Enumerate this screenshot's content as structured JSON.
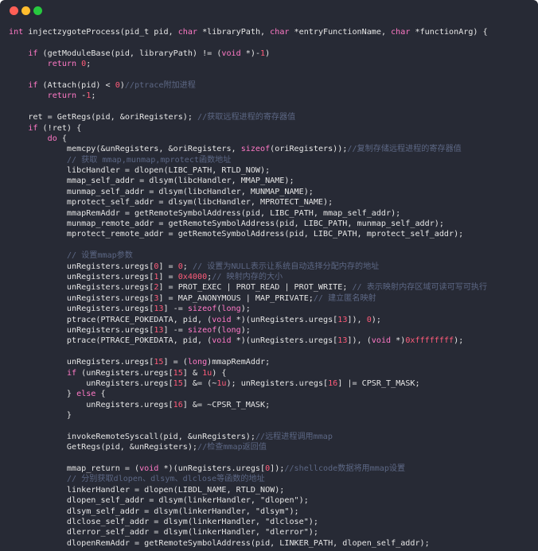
{
  "window": {
    "buttons": [
      {
        "name": "close-button",
        "color": "#ff5f56"
      },
      {
        "name": "minimize-button",
        "color": "#ffbd2e"
      },
      {
        "name": "maximize-button",
        "color": "#27c93f"
      }
    ]
  },
  "colors": {
    "background": "#272a35",
    "text": "#e6e6e6",
    "keyword": "#ff79c6",
    "number": "#ff5c7a",
    "comment": "#5c6784"
  },
  "code": {
    "lines": [
      [
        [
          "k",
          "int"
        ],
        [
          "t",
          " injectzygoteProcess(pid_t pid, "
        ],
        [
          "k",
          "char"
        ],
        [
          "t",
          " *libraryPath, "
        ],
        [
          "k",
          "char"
        ],
        [
          "t",
          " *entryFunctionName, "
        ],
        [
          "k",
          "char"
        ],
        [
          "t",
          " *functionArg) {"
        ]
      ],
      [],
      [
        [
          "t",
          "    "
        ],
        [
          "k",
          "if"
        ],
        [
          "t",
          " (getModuleBase(pid, libraryPath) != ("
        ],
        [
          "k",
          "void"
        ],
        [
          "t",
          " *)-"
        ],
        [
          "n",
          "1"
        ],
        [
          "t",
          ")"
        ]
      ],
      [
        [
          "t",
          "        "
        ],
        [
          "k",
          "return"
        ],
        [
          "t",
          " "
        ],
        [
          "n",
          "0"
        ],
        [
          "t",
          ";"
        ]
      ],
      [],
      [
        [
          "t",
          "    "
        ],
        [
          "k",
          "if"
        ],
        [
          "t",
          " (Attach(pid) < "
        ],
        [
          "n",
          "0"
        ],
        [
          "t",
          ")"
        ],
        [
          "c",
          "//ptrace附加进程"
        ]
      ],
      [
        [
          "t",
          "        "
        ],
        [
          "k",
          "return"
        ],
        [
          "t",
          " -"
        ],
        [
          "n",
          "1"
        ],
        [
          "t",
          ";"
        ]
      ],
      [],
      [
        [
          "t",
          "    ret = GetRegs(pid, &oriRegisters); "
        ],
        [
          "c",
          "//获取远程进程的寄存器值"
        ]
      ],
      [
        [
          "t",
          "    "
        ],
        [
          "k",
          "if"
        ],
        [
          "t",
          " (!ret) {"
        ]
      ],
      [
        [
          "t",
          "        "
        ],
        [
          "k",
          "do"
        ],
        [
          "t",
          " {"
        ]
      ],
      [
        [
          "t",
          "            memcpy(&unRegisters, &oriRegisters, "
        ],
        [
          "k",
          "sizeof"
        ],
        [
          "t",
          "(oriRegisters));"
        ],
        [
          "c",
          "//复制存储远程进程的寄存器值"
        ]
      ],
      [
        [
          "t",
          "            "
        ],
        [
          "c",
          "// 获取 mmap,munmap,mprotect函数地址"
        ]
      ],
      [
        [
          "t",
          "            libcHandler = dlopen(LIBC_PATH, RTLD_NOW);"
        ]
      ],
      [
        [
          "t",
          "            mmap_self_addr = dlsym(libcHandler, MMAP_NAME);"
        ]
      ],
      [
        [
          "t",
          "            munmap_self_addr = dlsym(libcHandler, MUNMAP_NAME);"
        ]
      ],
      [
        [
          "t",
          "            mprotect_self_addr = dlsym(libcHandler, MPROTECT_NAME);"
        ]
      ],
      [
        [
          "t",
          "            mmapRemAddr = getRemoteSymbolAddress(pid, LIBC_PATH, mmap_self_addr);"
        ]
      ],
      [
        [
          "t",
          "            munmap_remote_addr = getRemoteSymbolAddress(pid, LIBC_PATH, munmap_self_addr);"
        ]
      ],
      [
        [
          "t",
          "            mprotect_remote_addr = getRemoteSymbolAddress(pid, LIBC_PATH, mprotect_self_addr);"
        ]
      ],
      [],
      [
        [
          "t",
          "            "
        ],
        [
          "c",
          "// 设置mmap参数"
        ]
      ],
      [
        [
          "t",
          "            unRegisters.uregs["
        ],
        [
          "n",
          "0"
        ],
        [
          "t",
          "] = "
        ],
        [
          "n",
          "0"
        ],
        [
          "t",
          "; "
        ],
        [
          "c",
          "// 设置为NULL表示让系统自动选择分配内存的地址"
        ]
      ],
      [
        [
          "t",
          "            unRegisters.uregs["
        ],
        [
          "n",
          "1"
        ],
        [
          "t",
          "] = "
        ],
        [
          "n",
          "0x4000"
        ],
        [
          "t",
          ";"
        ],
        [
          "c",
          "// 映射内存的大小"
        ]
      ],
      [
        [
          "t",
          "            unRegisters.uregs["
        ],
        [
          "n",
          "2"
        ],
        [
          "t",
          "] = PROT_EXEC | PROT_READ | PROT_WRITE; "
        ],
        [
          "c",
          "// 表示映射内存区域可读可写可执行"
        ]
      ],
      [
        [
          "t",
          "            unRegisters.uregs["
        ],
        [
          "n",
          "3"
        ],
        [
          "t",
          "] = MAP_ANONYMOUS | MAP_PRIVATE;"
        ],
        [
          "c",
          "// 建立匿名映射"
        ]
      ],
      [
        [
          "t",
          "            unRegisters.uregs["
        ],
        [
          "n",
          "13"
        ],
        [
          "t",
          "] -= "
        ],
        [
          "k",
          "sizeof"
        ],
        [
          "t",
          "("
        ],
        [
          "k",
          "long"
        ],
        [
          "t",
          ");"
        ]
      ],
      [
        [
          "t",
          "            ptrace(PTRACE_POKEDATA, pid, ("
        ],
        [
          "k",
          "void"
        ],
        [
          "t",
          " *)(unRegisters.uregs["
        ],
        [
          "n",
          "13"
        ],
        [
          "t",
          "]), "
        ],
        [
          "n",
          "0"
        ],
        [
          "t",
          ");"
        ]
      ],
      [
        [
          "t",
          "            unRegisters.uregs["
        ],
        [
          "n",
          "13"
        ],
        [
          "t",
          "] -= "
        ],
        [
          "k",
          "sizeof"
        ],
        [
          "t",
          "("
        ],
        [
          "k",
          "long"
        ],
        [
          "t",
          ");"
        ]
      ],
      [
        [
          "t",
          "            ptrace(PTRACE_POKEDATA, pid, ("
        ],
        [
          "k",
          "void"
        ],
        [
          "t",
          " *)(unRegisters.uregs["
        ],
        [
          "n",
          "13"
        ],
        [
          "t",
          "]), ("
        ],
        [
          "k",
          "void"
        ],
        [
          "t",
          " *)"
        ],
        [
          "n",
          "0xffffffff"
        ],
        [
          "t",
          ");"
        ]
      ],
      [],
      [
        [
          "t",
          "            unRegisters.uregs["
        ],
        [
          "n",
          "15"
        ],
        [
          "t",
          "] = ("
        ],
        [
          "k",
          "long"
        ],
        [
          "t",
          ")mmapRemAddr;"
        ]
      ],
      [
        [
          "t",
          "            "
        ],
        [
          "k",
          "if"
        ],
        [
          "t",
          " (unRegisters.uregs["
        ],
        [
          "n",
          "15"
        ],
        [
          "t",
          "] & "
        ],
        [
          "n",
          "1u"
        ],
        [
          "t",
          ") {"
        ]
      ],
      [
        [
          "t",
          "                unRegisters.uregs["
        ],
        [
          "n",
          "15"
        ],
        [
          "t",
          "] &= (~"
        ],
        [
          "n",
          "1u"
        ],
        [
          "t",
          "); unRegisters.uregs["
        ],
        [
          "n",
          "16"
        ],
        [
          "t",
          "] |= CPSR_T_MASK;"
        ]
      ],
      [
        [
          "t",
          "            } "
        ],
        [
          "k",
          "else"
        ],
        [
          "t",
          " {"
        ]
      ],
      [
        [
          "t",
          "                unRegisters.uregs["
        ],
        [
          "n",
          "16"
        ],
        [
          "t",
          "] &= ~CPSR_T_MASK;"
        ]
      ],
      [
        [
          "t",
          "            }"
        ]
      ],
      [],
      [
        [
          "t",
          "            invokeRemoteSyscall(pid, &unRegisters);"
        ],
        [
          "c",
          "//远程进程调用mmap"
        ]
      ],
      [
        [
          "t",
          "            GetRegs(pid, &unRegisters);"
        ],
        [
          "c",
          "//检查mmap返回值"
        ]
      ],
      [],
      [
        [
          "t",
          "            mmap_return = ("
        ],
        [
          "k",
          "void"
        ],
        [
          "t",
          " *)(unRegisters.uregs["
        ],
        [
          "n",
          "0"
        ],
        [
          "t",
          "]);"
        ],
        [
          "c",
          "//shellcode数据将用mmap设置"
        ]
      ],
      [
        [
          "t",
          "            "
        ],
        [
          "c",
          "// 分别获取dlopen、dlsym、dlclose等函数的地址"
        ]
      ],
      [
        [
          "t",
          "            linkerHandler = dlopen(LIBDL_NAME, RTLD_NOW);"
        ]
      ],
      [
        [
          "t",
          "            dlopen_self_addr = dlsym(linkerHandler, \"dlopen\");"
        ]
      ],
      [
        [
          "t",
          "            dlsym_self_addr = dlsym(linkerHandler, \"dlsym\");"
        ]
      ],
      [
        [
          "t",
          "            dlclose_self_addr = dlsym(linkerHandler, \"dlclose\");"
        ]
      ],
      [
        [
          "t",
          "            dlerror_self_addr = dlsym(linkerHandler, \"dlerror\");"
        ]
      ],
      [
        [
          "t",
          "            dlopenRemAddr = getRemoteSymbolAddress(pid, LINKER_PATH, dlopen_self_addr);"
        ]
      ]
    ]
  }
}
